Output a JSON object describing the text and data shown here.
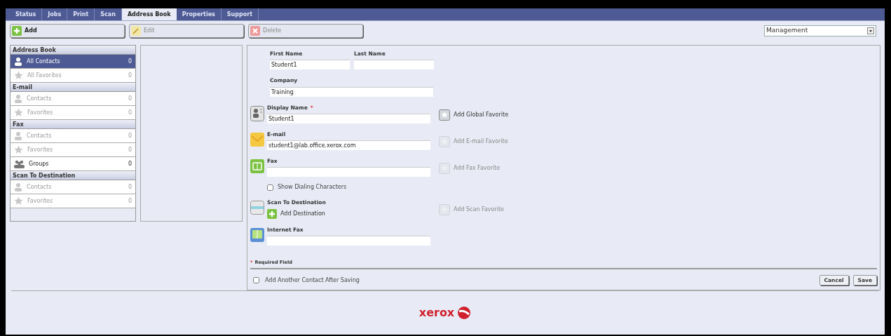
{
  "tabs": [
    {
      "label": "Status",
      "selected": false
    },
    {
      "label": "Jobs",
      "selected": false
    },
    {
      "label": "Print",
      "selected": false
    },
    {
      "label": "Scan",
      "selected": false
    },
    {
      "label": "Address Book",
      "selected": true
    },
    {
      "label": "Properties",
      "selected": false
    },
    {
      "label": "Support",
      "selected": false
    }
  ],
  "toolbar": {
    "buttons": [
      {
        "kind": "add",
        "label": "Add",
        "disabled": false
      },
      {
        "kind": "edit",
        "label": "Edit",
        "disabled": true
      },
      {
        "kind": "delete",
        "label": "Delete",
        "disabled": true
      }
    ],
    "dropdown": {
      "value": "Management"
    }
  },
  "sidebar": {
    "sections": [
      {
        "title": "Address Book",
        "items": [
          {
            "kind": "person",
            "label": "All Contacts",
            "count": "0",
            "selected": true,
            "disabled": false
          },
          {
            "kind": "star",
            "label": "All Favorites",
            "count": "0",
            "selected": false,
            "disabled": true
          }
        ]
      },
      {
        "title": "E-mail",
        "items": [
          {
            "kind": "person",
            "label": "Contacts",
            "count": "0",
            "selected": false,
            "disabled": true
          },
          {
            "kind": "star",
            "label": "Favorites",
            "count": "0",
            "selected": false,
            "disabled": true
          }
        ]
      },
      {
        "title": "Fax",
        "items": [
          {
            "kind": "person",
            "label": "Contacts",
            "count": "0",
            "selected": false,
            "disabled": true
          },
          {
            "kind": "star",
            "label": "Favorites",
            "count": "0",
            "selected": false,
            "disabled": true
          },
          {
            "kind": "group",
            "label": "Groups",
            "count": "0",
            "selected": false,
            "disabled": false
          }
        ]
      },
      {
        "title": "Scan To Destination",
        "items": [
          {
            "kind": "person",
            "label": "Contacts",
            "count": "0",
            "selected": false,
            "disabled": true
          },
          {
            "kind": "star",
            "label": "Favorites",
            "count": "0",
            "selected": false,
            "disabled": true
          }
        ]
      }
    ]
  },
  "contact_form": {
    "name_fields": [
      {
        "label": "First Name",
        "value": "Student1"
      },
      {
        "label": "Last Name"
      }
    ],
    "company": {
      "label": "Company",
      "value": "Training"
    },
    "sections": [
      {
        "kind": "display_name",
        "label": "Display Name",
        "required_mark": "*",
        "value": "Student1",
        "favorite": {
          "label": "Add Global Favorite",
          "disabled": false
        }
      },
      {
        "kind": "email",
        "label": "E-mail",
        "value": "student1@lab.office.xerox.com",
        "favorite": {
          "label": "Add E-mail Favorite",
          "disabled": true
        }
      },
      {
        "kind": "fax",
        "label": "Fax",
        "favorite": {
          "label": "Add Fax Favorite",
          "disabled": true
        },
        "option": {
          "label": "Show Dialing Characters",
          "checked": false
        }
      },
      {
        "kind": "scan",
        "label": "Scan To Destination",
        "action": "Add Destination",
        "favorite": {
          "label": "Add Scan Favorite",
          "disabled": true
        }
      },
      {
        "kind": "internet_fax",
        "label": "Internet Fax"
      }
    ],
    "required_note": {
      "mark": "*",
      "text": "Required Field"
    },
    "add_another": {
      "label": "Add Another Contact After Saving",
      "checked": false
    },
    "buttons": [
      "Cancel",
      "Save"
    ]
  },
  "footer": {
    "logo": "xerox"
  }
}
